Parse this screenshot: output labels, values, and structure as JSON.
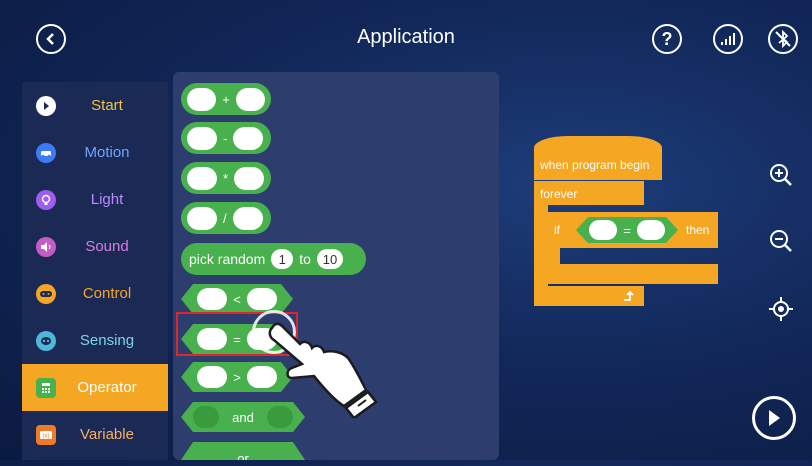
{
  "header": {
    "title": "Application"
  },
  "sidebar": {
    "items": [
      {
        "label": "Start",
        "icon": "play-icon",
        "color": "#ffffff"
      },
      {
        "label": "Motion",
        "icon": "car-icon",
        "color": "#3d7bf5"
      },
      {
        "label": "Light",
        "icon": "bulb-icon",
        "color": "#a05cf0"
      },
      {
        "label": "Sound",
        "icon": "speaker-icon",
        "color": "#c45cc8"
      },
      {
        "label": "Control",
        "icon": "gamepad-icon",
        "color": "#f5a623"
      },
      {
        "label": "Sensing",
        "icon": "sensor-icon",
        "color": "#4fb8d8"
      },
      {
        "label": "Operator",
        "icon": "calculator-icon",
        "color": "#48b04c"
      },
      {
        "label": "Variable",
        "icon": "variable-icon",
        "color": "#f07a2a"
      }
    ],
    "active": "Operator",
    "label_colors": {
      "Start": "#f5c242",
      "Motion": "#6ea4ff",
      "Light": "#b98cff",
      "Sound": "#d87ddf",
      "Control": "#f5a623",
      "Sensing": "#7fd3ec",
      "Operator": "#ffffff",
      "Variable": "#f5b060"
    }
  },
  "palette": {
    "ops": [
      "+",
      "-",
      "*",
      "/"
    ],
    "pick_random": {
      "label": "pick random",
      "from": "1",
      "to_label": "to",
      "to": "10"
    },
    "compare": [
      "<",
      "=",
      ">"
    ],
    "and_label": "and",
    "or_label": "or"
  },
  "script": {
    "hat": "when program begin",
    "forever": "forever",
    "if_label": "if",
    "op": "=",
    "then_label": "then"
  },
  "colors": {
    "operator": "#48b04c",
    "control": "#f5a623",
    "highlight": "#e0262b"
  }
}
